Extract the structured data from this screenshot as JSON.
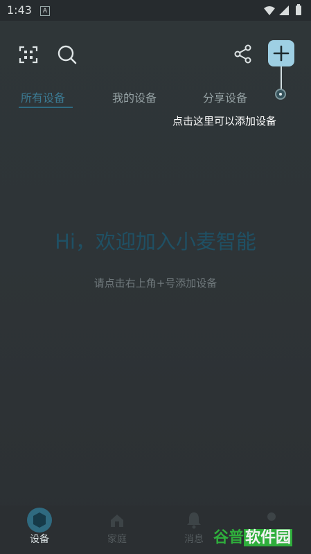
{
  "status_bar": {
    "time": "1:43",
    "notif_letter": "A"
  },
  "toolbar": {
    "icons": [
      "scan-icon",
      "search-icon",
      "share-icon",
      "add-icon"
    ]
  },
  "tabs": [
    {
      "label": "所有设备"
    },
    {
      "label": "我的设备"
    },
    {
      "label": "分享设备"
    }
  ],
  "guide": {
    "text": "点击这里可以添加设备"
  },
  "empty_state": {
    "title": "Hi，欢迎加入小麦智能",
    "subtitle": "请点击右上角+号添加设备"
  },
  "bottom_nav": [
    {
      "label": "设备",
      "icon": "hexagon-icon"
    },
    {
      "label": "家庭",
      "icon": "home-icon"
    },
    {
      "label": "消息",
      "icon": "bell-icon"
    },
    {
      "label": "",
      "icon": "profile-icon"
    }
  ],
  "watermark": {
    "part1": "谷普",
    "part2": "软件园"
  },
  "colors": {
    "accent": "#2f6a80",
    "add_button": "#9ecfe3",
    "overlay": "#2e3437"
  }
}
